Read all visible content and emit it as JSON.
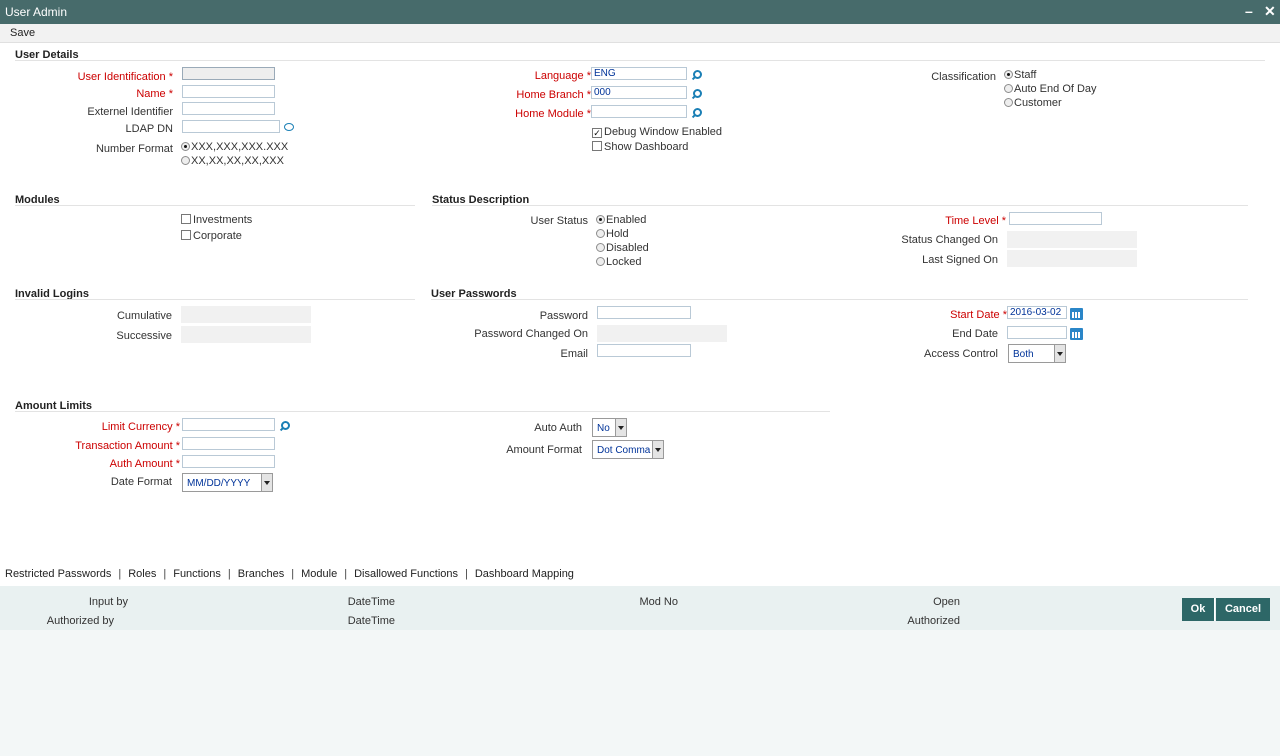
{
  "window": {
    "title": "User Admin",
    "minimize_label": "–",
    "close_label": "✕"
  },
  "toolbar": {
    "save_label": "Save"
  },
  "user_details": {
    "heading": "User Details",
    "user_identification_label": "User Identification",
    "name_label": "Name",
    "external_identifier_label": "Externel Identifier",
    "ldap_dn_label": "LDAP DN",
    "number_format_label": "Number Format",
    "number_format_options": [
      "XXX,XXX,XXX.XXX",
      "XX,XX,XX,XX,XXX"
    ],
    "language_label": "Language",
    "language_value": "ENG",
    "home_branch_label": "Home Branch",
    "home_branch_value": "000",
    "home_module_label": "Home Module",
    "debug_window_label": "Debug Window Enabled",
    "show_dashboard_label": "Show Dashboard",
    "classification_label": "Classification",
    "classification_options": [
      "Staff",
      "Auto End Of Day",
      "Customer"
    ],
    "required_mark": "*"
  },
  "modules": {
    "heading": "Modules",
    "items": [
      "Investments",
      "Corporate"
    ]
  },
  "status_description": {
    "heading": "Status Description",
    "user_status_label": "User Status",
    "user_status_options": [
      "Enabled",
      "Hold",
      "Disabled",
      "Locked"
    ],
    "time_level_label": "Time Level",
    "status_changed_on_label": "Status Changed On",
    "last_signed_on_label": "Last Signed On"
  },
  "invalid_logins": {
    "heading": "Invalid Logins",
    "cumulative_label": "Cumulative",
    "successive_label": "Successive"
  },
  "user_passwords": {
    "heading": "User Passwords",
    "password_label": "Password",
    "password_changed_on_label": "Password Changed On",
    "email_label": "Email",
    "start_date_label": "Start Date",
    "start_date_value": "2016-03-02",
    "end_date_label": "End Date",
    "access_control_label": "Access Control",
    "access_control_value": "Both"
  },
  "amount_limits": {
    "heading": "Amount Limits",
    "limit_currency_label": "Limit Currency",
    "transaction_amount_label": "Transaction Amount",
    "auth_amount_label": "Auth Amount",
    "date_format_label": "Date Format",
    "date_format_value": "MM/DD/YYYY",
    "auto_auth_label": "Auto Auth",
    "auto_auth_value": "No",
    "amount_format_label": "Amount Format",
    "amount_format_value": "Dot Comma"
  },
  "tabs": [
    "Restricted Passwords",
    "Roles",
    "Functions",
    "Branches",
    "Module",
    "Disallowed Functions",
    "Dashboard Mapping"
  ],
  "tab_separator": "|",
  "footer": {
    "input_by_label": "Input by",
    "authorized_by_label": "Authorized by",
    "datetime_label_1": "DateTime",
    "datetime_label_2": "DateTime",
    "mod_no_label": "Mod No",
    "open_label": "Open",
    "authorized_label": "Authorized",
    "ok_label": "Ok",
    "cancel_label": "Cancel"
  }
}
